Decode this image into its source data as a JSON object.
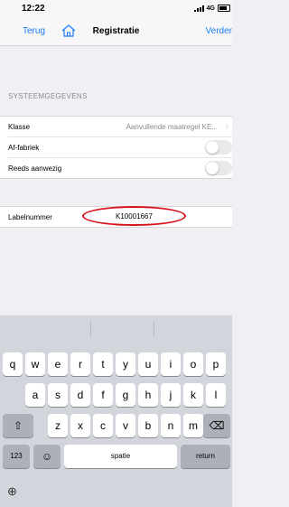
{
  "status_bar": {
    "time": "12:22",
    "network": "4G"
  },
  "nav": {
    "back_label": "Terug",
    "title": "Registratie",
    "next_label": "Verder"
  },
  "section": {
    "header": "SYSTEEMGEGEVENS"
  },
  "rows": [
    {
      "label": "Klasse",
      "value": "Aanvullende maatregel KE..."
    },
    {
      "label": "Af-fabriek"
    },
    {
      "label": "Reeds aanwezig"
    }
  ],
  "label_field": {
    "label": "Labelnummer",
    "value": "K10001667"
  },
  "keyboard": {
    "row1": [
      "q",
      "w",
      "e",
      "r",
      "t",
      "y",
      "u",
      "i",
      "o",
      "p"
    ],
    "row2": [
      "a",
      "s",
      "d",
      "f",
      "g",
      "h",
      "j",
      "k",
      "l"
    ],
    "row3": [
      "z",
      "x",
      "c",
      "v",
      "b",
      "n",
      "m"
    ],
    "numbers_label": "123",
    "space_label": "spatie",
    "return_label": "return"
  },
  "colors": {
    "accent": "#1a7cf5",
    "annotation": "#d6131b"
  }
}
